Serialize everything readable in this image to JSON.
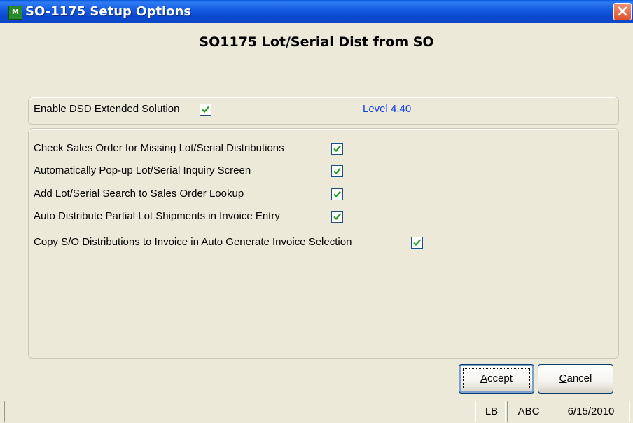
{
  "window": {
    "title": "SO-1175 Setup Options",
    "app_icon_text": "M"
  },
  "heading": "SO1175 Lot/Serial Dist from SO",
  "extended": {
    "label": "Enable DSD Extended Solution",
    "checked": true,
    "level": "Level  4.40"
  },
  "options": [
    {
      "label": "Check Sales Order for Missing Lot/Serial Distributions",
      "checked": true
    },
    {
      "label": "Automatically Pop-up Lot/Serial Inquiry Screen",
      "checked": true
    },
    {
      "label": "Add Lot/Serial Search to Sales Order Lookup",
      "checked": true
    },
    {
      "label": "Auto Distribute Partial Lot Shipments in Invoice Entry",
      "checked": true
    },
    {
      "label": "Copy S/O Distributions to Invoice in Auto Generate Invoice Selection",
      "checked": true
    }
  ],
  "buttons": {
    "accept_hotkey": "A",
    "accept_rest": "ccept",
    "cancel_hotkey": "C",
    "cancel_rest": "ancel"
  },
  "status": {
    "main": "",
    "user": "LB",
    "company": "ABC",
    "date": "6/15/2010"
  },
  "icons": {
    "app": "mas90-app-icon",
    "close": "close-icon",
    "check": "checkmark-icon"
  },
  "colors": {
    "titlebar": "#0a49d0",
    "level_text": "#1240e0",
    "check": "#21a121",
    "close": "#e0512b"
  }
}
